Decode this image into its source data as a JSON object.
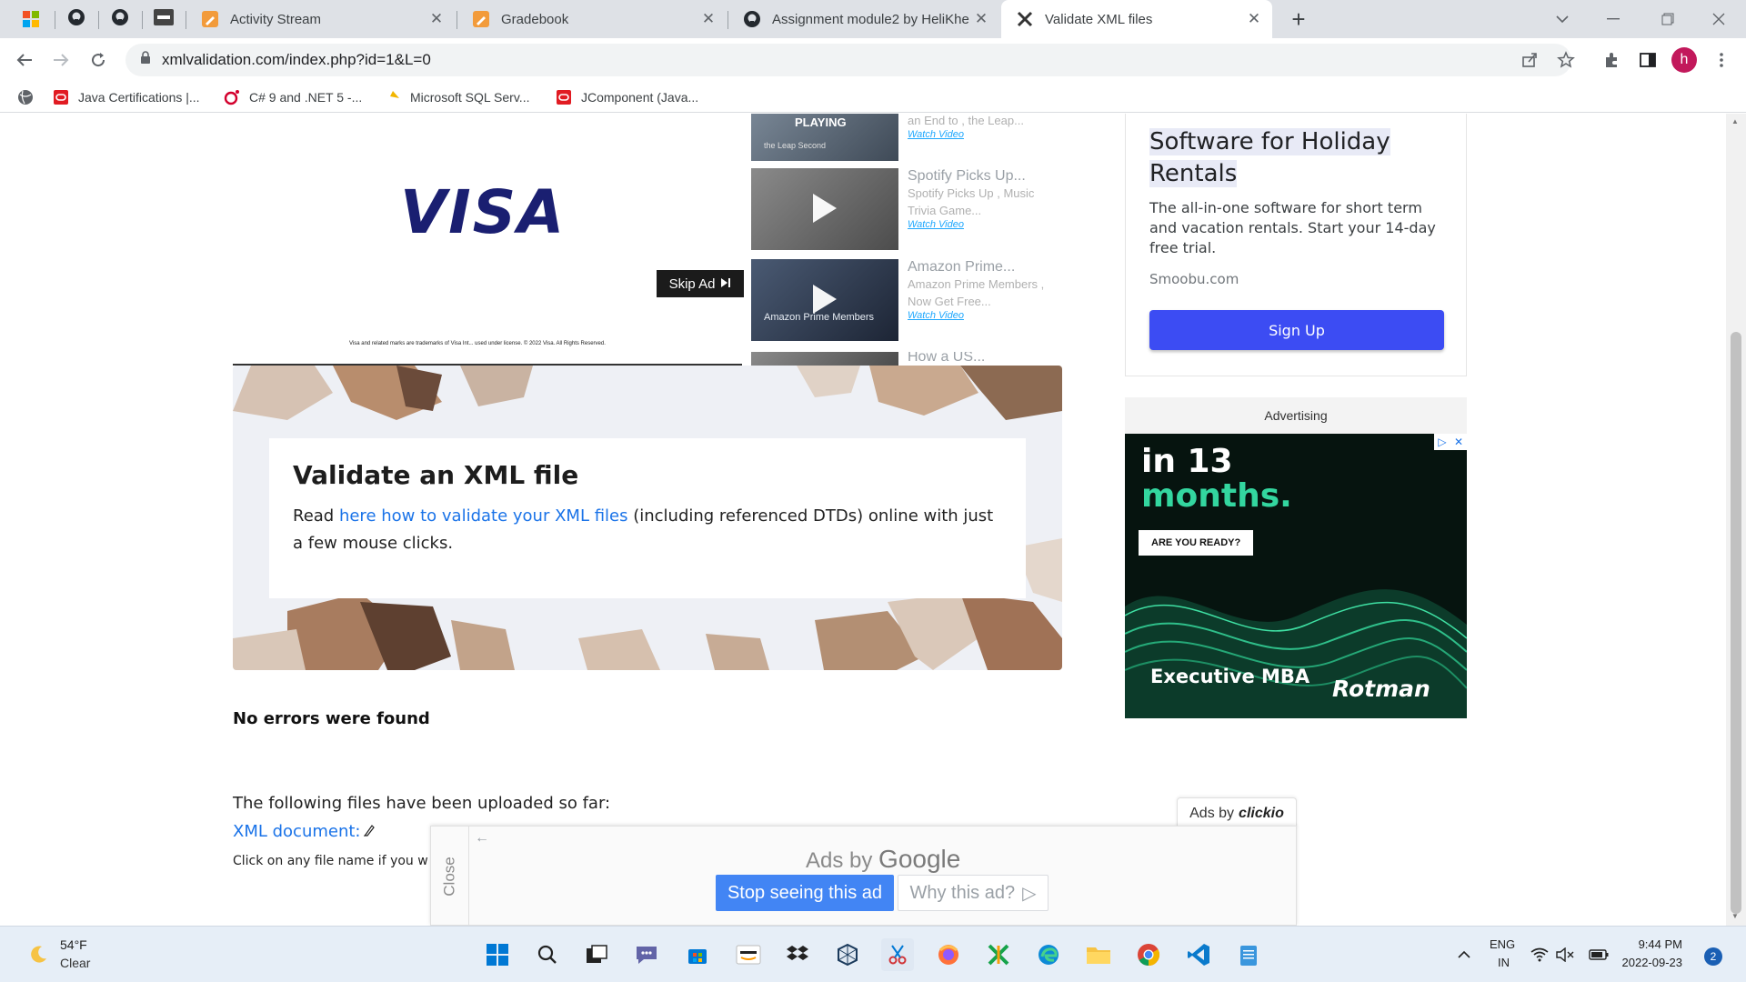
{
  "browser": {
    "tabs": [
      {
        "title": "Activity Stream",
        "icon": "pencil-icon",
        "active": false
      },
      {
        "title": "Gradebook",
        "icon": "pencil-icon",
        "active": false
      },
      {
        "title": "Assignment module2 by HeliKhe",
        "icon": "github-icon",
        "active": false
      },
      {
        "title": "Validate XML files",
        "icon": "xml-validation-icon",
        "active": true
      }
    ],
    "new_tab_label": "+",
    "close_glyph": "✕",
    "url": "xmlvalidation.com/index.php?id=1&L=0",
    "profile_initial": "h",
    "bookmarks": [
      {
        "label": "Java Certifications |...",
        "icon": "oracle-icon"
      },
      {
        "label": "C# 9 and .NET 5 -...",
        "icon": "oreilly-icon"
      },
      {
        "label": "Microsoft SQL Serv...",
        "icon": "sql-icon"
      },
      {
        "label": "JComponent (Java...",
        "icon": "oracle-icon"
      }
    ]
  },
  "video_ad": {
    "brand": "VISA",
    "skip_label": "Skip Ad",
    "fine_print": "Visa and related marks are trademarks of Visa Int... used under license. © 2022 Visa. All Rights Reserved.",
    "playlist": [
      {
        "title": "",
        "desc": "an End to , the Leap...",
        "link": "Watch Video",
        "badge": "PLAYING",
        "thumb_text": "the Leap Second"
      },
      {
        "title": "Spotify Picks Up...",
        "desc": "Spotify Picks Up , Music Trivia Game...",
        "link": "Watch Video",
        "badge": "",
        "thumb_text": ""
      },
      {
        "title": "Amazon Prime...",
        "desc": "Amazon Prime Members , Now Get Free...",
        "link": "Watch Video",
        "badge": "",
        "thumb_text": "Amazon Prime Members"
      },
      {
        "title": "How a US...",
        "desc": "",
        "link": "",
        "badge": "",
        "thumb_text": ""
      }
    ]
  },
  "hero": {
    "title": "Validate an XML file",
    "text_before": "Read ",
    "link": "here how to validate your XML files",
    "text_after": " (including referenced DTDs) online with just a few mouse clicks."
  },
  "result": {
    "status": "No errors were found",
    "files_heading": "The following files have been uploaded so far:",
    "file_link": "XML document:",
    "hint": "Click on any file name if you w"
  },
  "side_ad": {
    "title": "Software for Holiday Rentals",
    "desc": "The all-in-one software for short term and vacation rentals. Start your 14-day free trial.",
    "domain": "Smoobu.com",
    "cta": "Sign Up"
  },
  "advertising_label": "Advertising",
  "rotman_ad": {
    "line1": "in 13",
    "line2": "months.",
    "ready": "ARE YOU READY?",
    "program": "Executive MBA",
    "brand": "Rotman"
  },
  "google_ad": {
    "clickio_prefix": "Ads by",
    "clickio_brand": "clickio",
    "close_label": "Close",
    "ads_by": "Ads by",
    "google": "Google",
    "stop": "Stop seeing this ad",
    "why": "Why this ad?"
  },
  "taskbar": {
    "weather_temp": "54°F",
    "weather_cond": "Clear",
    "lang": "ENG",
    "region": "IN",
    "time": "9:44 PM",
    "date": "2022-09-23",
    "notifications": "2"
  },
  "colors": {
    "accent": "#1a73e8",
    "signup": "#3c4cf3",
    "google_blue": "#4285f4",
    "rotman_green": "#33d69f"
  }
}
